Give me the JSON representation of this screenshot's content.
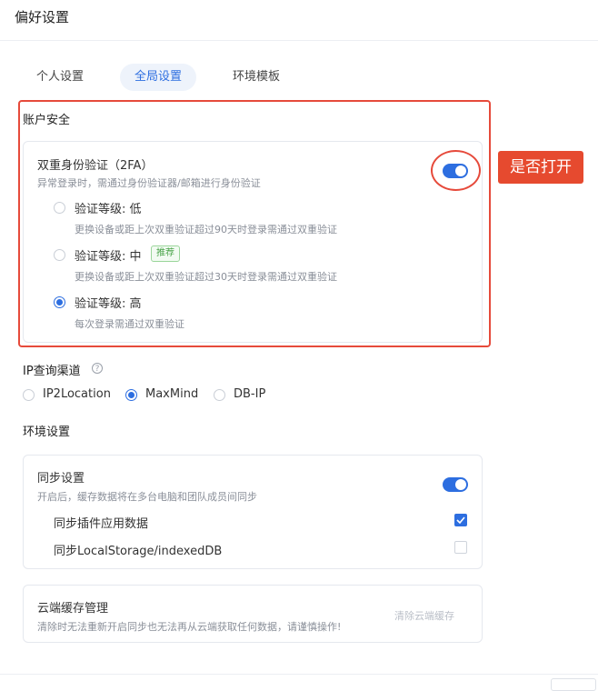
{
  "page": {
    "title": "偏好设置"
  },
  "tabs": [
    {
      "label": "个人设置"
    },
    {
      "label": "全局设置",
      "active": true
    },
    {
      "label": "环境模板"
    }
  ],
  "account_security": {
    "section_title": "账户安全",
    "twofa": {
      "title": "双重身份验证（2FA）",
      "desc": "异常登录时，需通过身份验证器/邮箱进行身份验证",
      "enabled": true
    },
    "levels": [
      {
        "label": "验证等级: 低",
        "desc": "更换设备或距上次双重验证超过90天时登录需通过双重验证",
        "selected": false
      },
      {
        "label": "验证等级: 中",
        "badge": "推荐",
        "desc": "更换设备或距上次双重验证超过30天时登录需通过双重验证",
        "selected": false
      },
      {
        "label": "验证等级: 高",
        "desc": "每次登录需通过双重验证",
        "selected": true
      }
    ]
  },
  "annotation": {
    "callout": "是否打开"
  },
  "ip_channel": {
    "title": "IP查询渠道",
    "help_icon": "?",
    "options": [
      {
        "label": "IP2Location",
        "selected": false
      },
      {
        "label": "MaxMind",
        "selected": true
      },
      {
        "label": "DB-IP",
        "selected": false
      }
    ]
  },
  "env_settings": {
    "section_title": "环境设置",
    "sync": {
      "title": "同步设置",
      "desc": "开启后，缓存数据将在多台电脑和团队成员间同步",
      "enabled": true,
      "items": [
        {
          "label": "同步插件应用数据",
          "checked": true
        },
        {
          "label": "同步LocalStorage/indexedDB",
          "checked": false
        }
      ]
    },
    "cloud_cache": {
      "title": "云端缓存管理",
      "desc": "清除时无法重新开启同步也无法再从云端获取任何数据，请谨慎操作!",
      "button": "清除云端缓存"
    }
  },
  "colors": {
    "accent": "#2d6ee0",
    "annotation_red": "#e64a3b",
    "badge_green": "#4aa44a"
  }
}
